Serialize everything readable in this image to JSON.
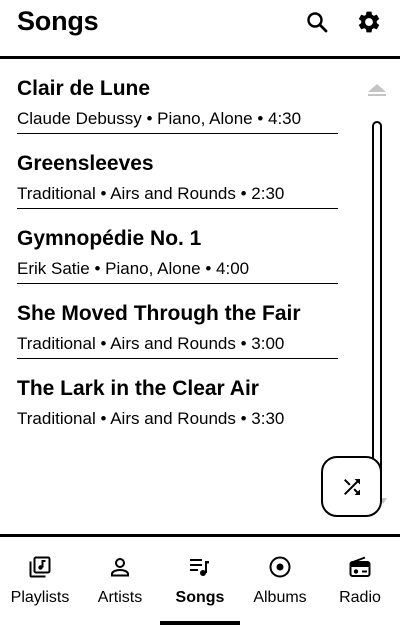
{
  "header": {
    "title": "Songs",
    "search_icon": "search-icon",
    "settings_icon": "gear-icon"
  },
  "songs": [
    {
      "title": "Clair de Lune",
      "meta": "Claude Debussy • Piano, Alone • 4:30"
    },
    {
      "title": "Greensleeves",
      "meta": "Traditional • Airs and Rounds • 2:30"
    },
    {
      "title": "Gymnopédie No. 1",
      "meta": "Erik Satie • Piano, Alone • 4:00"
    },
    {
      "title": "She Moved Through the Fair",
      "meta": "Traditional • Airs and Rounds • 3:00"
    },
    {
      "title": "The Lark in the Clear Air",
      "meta": "Traditional • Airs and Rounds • 3:30"
    }
  ],
  "fab": {
    "icon": "shuffle-icon"
  },
  "nav": {
    "active": "Songs",
    "items": [
      {
        "label": "Playlists",
        "icon": "playlist-icon"
      },
      {
        "label": "Artists",
        "icon": "person-icon"
      },
      {
        "label": "Songs",
        "icon": "queue-music-icon"
      },
      {
        "label": "Albums",
        "icon": "album-icon"
      },
      {
        "label": "Radio",
        "icon": "radio-icon"
      }
    ]
  },
  "colors": {
    "foreground": "#000000",
    "background": "#ffffff",
    "muted": "#9e9e9e"
  }
}
